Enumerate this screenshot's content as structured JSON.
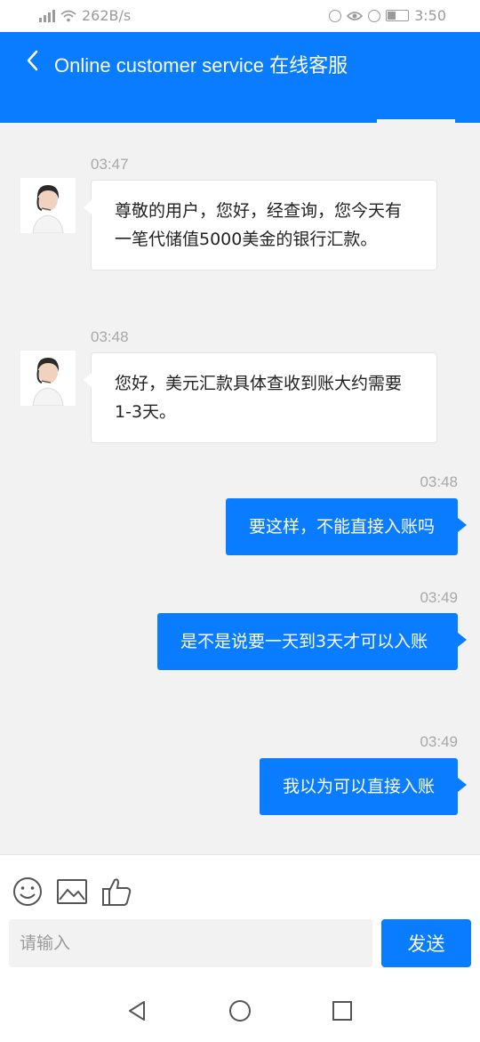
{
  "status_bar": {
    "net_speed": "262B/s",
    "time": "3:50",
    "battery_level": 0.45
  },
  "header": {
    "title": "Online customer service 在线客服"
  },
  "messages": [
    {
      "direction": "in",
      "time": "03:47",
      "text": "尊敬的用户，您好，经查询，您今天有一笔代储值5000美金的银行汇款。"
    },
    {
      "direction": "in",
      "time": "03:48",
      "text": "您好，美元汇款具体查收到账大约需要1-3天。"
    },
    {
      "direction": "out",
      "time": "03:48",
      "text": "要这样，不能直接入账吗"
    },
    {
      "direction": "out",
      "time": "03:49",
      "text": "是不是说要一天到3天才可以入账"
    },
    {
      "direction": "out",
      "time": "03:49",
      "text": "我以为可以直接入账"
    }
  ],
  "composer": {
    "placeholder": "请输入",
    "value": "",
    "send_label": "发送"
  },
  "colors": {
    "brand": "#0a7cff",
    "background": "#f2f2f2"
  },
  "icons": [
    "emoji-icon",
    "image-icon",
    "thumbs-up-icon",
    "back-nav-icon",
    "home-nav-icon",
    "recents-nav-icon"
  ]
}
